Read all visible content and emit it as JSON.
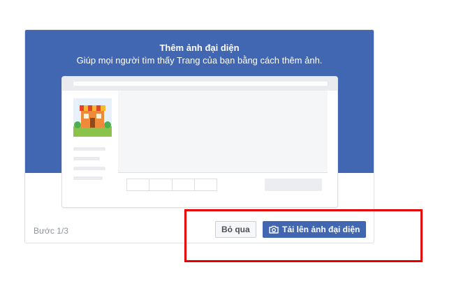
{
  "dialog": {
    "title": "Thêm ảnh đại diện",
    "subtitle": "Giúp mọi người tìm thấy Trang của bạn bằng cách thêm ảnh.",
    "step_label": "Bước 1/3",
    "skip_label": "Bỏ qua",
    "upload_label": "Tải lên ảnh đại diện",
    "upload_icon": "camera-icon"
  },
  "colors": {
    "header_bg": "#4267b2",
    "primary_button": "#4267b2",
    "highlight_box": "#e60000"
  }
}
